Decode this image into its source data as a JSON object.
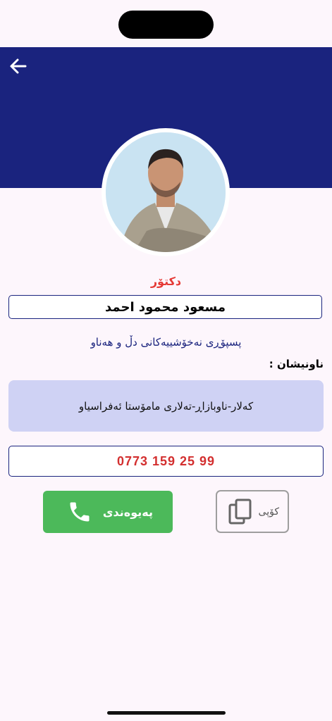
{
  "profile": {
    "title": "دکتۆر",
    "name": "مسعود محمود احمد",
    "specialty": "پسپۆڕی نەخۆشییەکانی دڵ و هەناو"
  },
  "address": {
    "label": "ناونیشان :",
    "value": "کەلار-ناوبازاڕ-تەلاری مامۆستا ئەفراسیاو"
  },
  "phone": {
    "number": "0773 159 25 99"
  },
  "actions": {
    "contact_label": "پەیوەندی",
    "copy_label": "کۆپی"
  },
  "icons": {
    "back": "back-arrow-icon",
    "phone": "phone-icon",
    "copy": "copy-icon"
  },
  "colors": {
    "header": "#1a237e",
    "accent_red": "#e53935",
    "contact_green": "#4cb95a",
    "address_bg": "#cfd2f4"
  }
}
